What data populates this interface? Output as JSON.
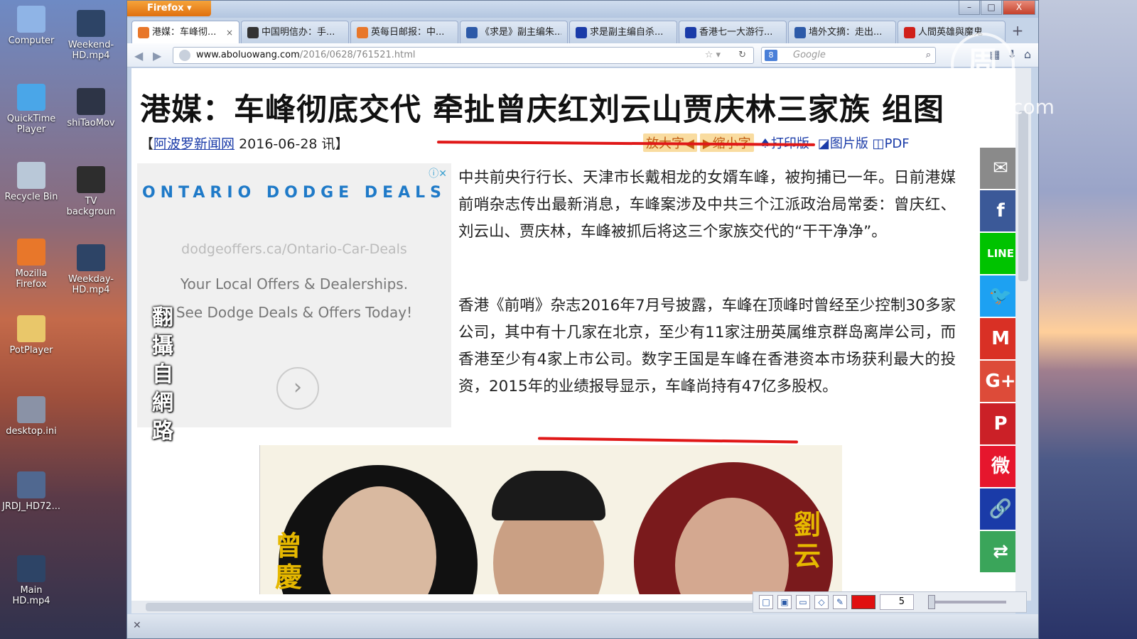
{
  "desktop": {
    "icons": [
      {
        "label": "Computer",
        "icon": "computer-icon",
        "color": "#8fb4e6"
      },
      {
        "label": "Weekend-HD.mp4",
        "icon": "video-file-icon",
        "color": "#2d4466"
      },
      {
        "label": "QuickTime Player",
        "icon": "quicktime-icon",
        "color": "#4aa6e8"
      },
      {
        "label": "shiTaoMov",
        "icon": "video-file-icon",
        "color": "#2d3446"
      },
      {
        "label": "Recycle Bin",
        "icon": "recycle-bin-icon",
        "color": "#b9c8d8"
      },
      {
        "label": "TV backgroun",
        "icon": "video-file-icon",
        "color": "#2d2d2d"
      },
      {
        "label": "Mozilla Firefox",
        "icon": "firefox-icon",
        "color": "#e8772a"
      },
      {
        "label": "Weekday-HD.mp4",
        "icon": "video-file-icon",
        "color": "#2d4466"
      },
      {
        "label": "PotPlayer",
        "icon": "folder-icon",
        "color": "#e9c76a"
      },
      {
        "label": "desktop.ini",
        "icon": "settings-file-icon",
        "color": "#8a92a6"
      },
      {
        "label": "JRDJ_HD72...",
        "icon": "video-file-icon",
        "color": "#506890"
      },
      {
        "label": "Main HD.mp4",
        "icon": "video-file-icon",
        "color": "#2d4466"
      }
    ]
  },
  "browser": {
    "app_button": "Firefox",
    "window_controls": {
      "minimize": "–",
      "maximize": "□",
      "close": "X"
    },
    "tabs": [
      {
        "title": "港媒：车峰彻...",
        "active": true,
        "favicon_color": "#e8772a"
      },
      {
        "title": "中国明信办：手...",
        "active": false,
        "favicon_color": "#333333"
      },
      {
        "title": "英每日邮报：中...",
        "active": false,
        "favicon_color": "#e8772a"
      },
      {
        "title": "《求是》副主编朱...",
        "active": false,
        "favicon_color": "#2d5aa8"
      },
      {
        "title": "求是副主编自杀...",
        "active": false,
        "favicon_color": "#1a3ba8"
      },
      {
        "title": "香港七一大游行...",
        "active": false,
        "favicon_color": "#1a3ba8"
      },
      {
        "title": "墙外文摘：走出...",
        "active": false,
        "favicon_color": "#2d5aa8"
      },
      {
        "title": "人間英雄與魔鬼",
        "active": false,
        "favicon_color": "#d0201a"
      }
    ],
    "new_tab_label": "+",
    "url_domain": "www.aboluowang.com",
    "url_path": "/2016/0628/761521.html",
    "search_placeholder": "Google",
    "search_engine_label": "8"
  },
  "article": {
    "headline": "港媒：车峰彻底交代 牵扯曾庆红刘云山贾庆林三家族 组图",
    "byline_open": "【",
    "byline_source": "阿波罗新闻网",
    "byline_date": " 2016-06-28 讯】",
    "tools": {
      "enlarge": "放大字◀",
      "shrink": "▶缩小字",
      "print": "♠打印版",
      "image_pdf": "◪图片版 ◫PDF"
    },
    "paragraph_1": "中共前央行行长、天津市长戴相龙的女婿车峰，被拘捕已一年。日前港媒前哨杂志传出最新消息，车峰案涉及中共三个江派政治局常委：曾庆红、刘云山、贾庆林，车峰被抓后将这三个家族交代的“干干净净”。",
    "paragraph_2": "香港《前哨》杂志2016年7月号披露，车峰在顶峰时曾经至少控制30多家公司，其中有十几家在北京，至少有11家注册英属维京群岛离岸公司，而香港至少有4家上市公司。数字王国是车峰在香港资本市场获利最大的投资，2015年的业绩报导显示，车峰尚持有47亿多股权。",
    "figure_label_left": "曾慶",
    "figure_label_right": "劉云"
  },
  "ad": {
    "title": "ONTARIO DODGE DEALS",
    "url": "dodgeoffers.ca/Ontario-Car-Deals",
    "text": "Your Local Offers & Dealerships. See Dodge Deals & Offers Today!",
    "adchoices_label": "ⓘ✕",
    "arrow": "›"
  },
  "overlay": {
    "vertical_caption": "翻攝自網路",
    "logo_glyph": "周",
    "logo_text": "dtv.com"
  },
  "share_buttons": [
    {
      "name": "email",
      "glyph": "✉",
      "color": "#8a8a8a"
    },
    {
      "name": "facebook",
      "glyph": "f",
      "color": "#3b5998"
    },
    {
      "name": "line",
      "glyph": "LINE",
      "color": "#00c300"
    },
    {
      "name": "twitter",
      "glyph": "🐦",
      "color": "#1da1f2"
    },
    {
      "name": "gmail",
      "glyph": "M",
      "color": "#d93025"
    },
    {
      "name": "google-plus",
      "glyph": "G+",
      "color": "#dd4b39"
    },
    {
      "name": "pinterest",
      "glyph": "P",
      "color": "#cb2027"
    },
    {
      "name": "weibo",
      "glyph": "微",
      "color": "#e6162d"
    },
    {
      "name": "link",
      "glyph": "🔗",
      "color": "#1a3ba8"
    },
    {
      "name": "share-more",
      "glyph": "⇄",
      "color": "#3aa55a"
    }
  ],
  "draw_toolbar": {
    "pen_size": "5"
  },
  "colors": {
    "annotation_red": "#e01818",
    "link_blue": "#1a3ba8",
    "ad_blue": "#1f7ac8"
  }
}
